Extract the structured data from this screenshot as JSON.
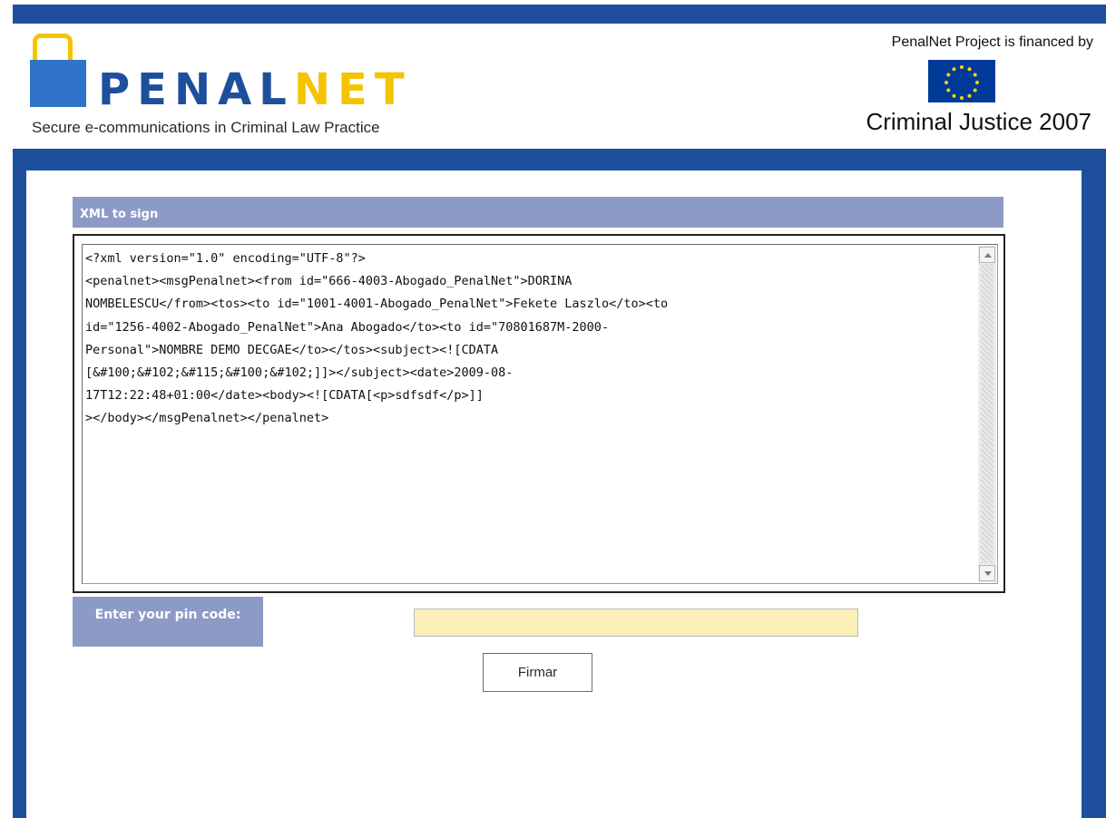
{
  "header": {
    "logo_penal": "PENAL",
    "logo_net": "NET",
    "tagline": "Secure e-communications in Criminal Law Practice",
    "financed_by": "PenalNet Project is financed by",
    "program_name": "Criminal Justice 2007"
  },
  "form": {
    "section_title": "XML to sign",
    "xml_text": "<?xml version=\"1.0\" encoding=\"UTF-8\"?>\n<penalnet><msgPenalnet><from id=\"666-4003-Abogado_PenalNet\">DORINA\nNOMBELESCU</from><tos><to id=\"1001-4001-Abogado_PenalNet\">Fekete Laszlo</to><to\nid=\"1256-4002-Abogado_PenalNet\">Ana Abogado</to><to id=\"70801687M-2000-\nPersonal\">NOMBRE DEMO DECGAE</to></tos><subject><![CDATA\n[&#100;&#102;&#115;&#100;&#102;]]></subject><date>2009-08-\n17T12:22:48+01:00</date><body><![CDATA[<p>sdfsdf</p>]]\n></body></msgPenalnet></penalnet>",
    "pin_label": "Enter your pin code:",
    "pin_value": "",
    "submit_label": "Firmar"
  },
  "colors": {
    "brand_blue": "#1e4f9c",
    "brand_yellow": "#f5c400",
    "panel_header_bg": "#8e9ac6",
    "pin_input_bg": "#fcefb8"
  }
}
